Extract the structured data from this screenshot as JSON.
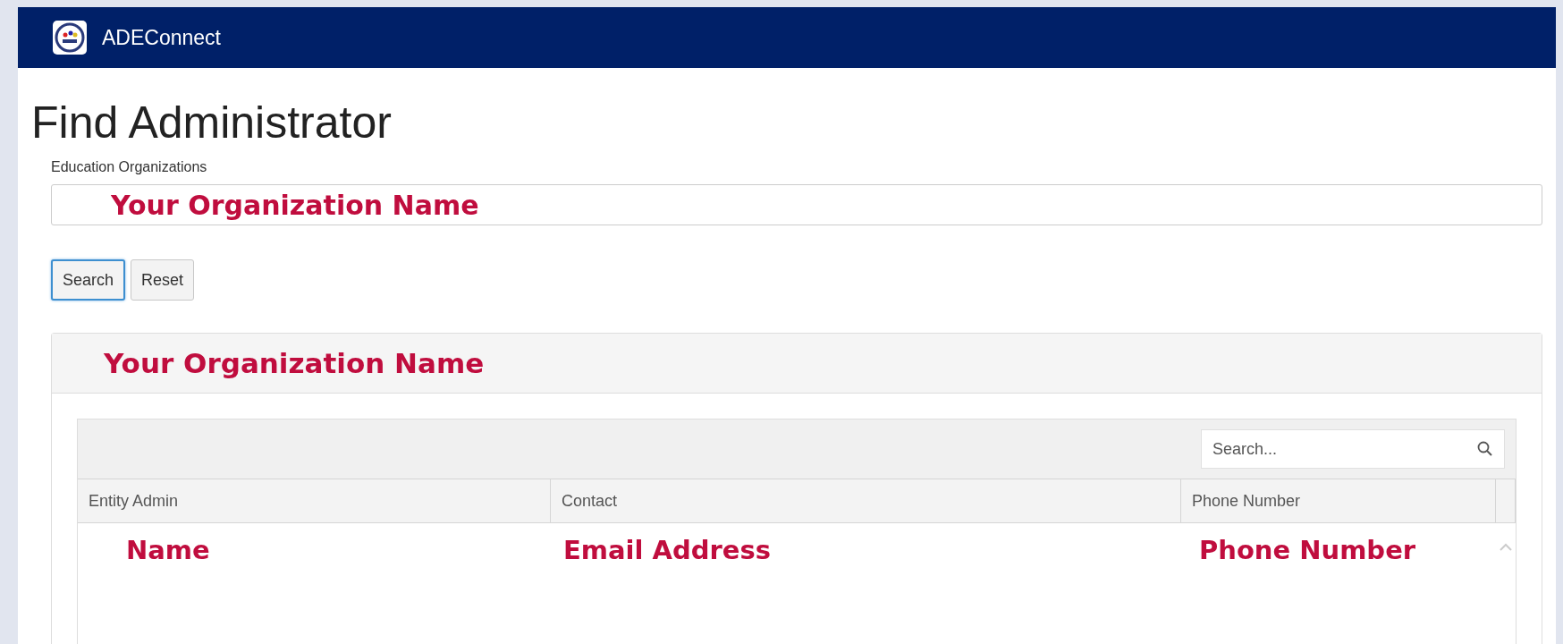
{
  "navbar": {
    "brand": "ADEConnect"
  },
  "page_title": "Find Administrator",
  "org_field": {
    "label": "Education Organizations",
    "value": "Your Organization Name"
  },
  "buttons": [
    {
      "label": "Search",
      "focused": true
    },
    {
      "label": "Reset",
      "focused": false
    }
  ],
  "panel": {
    "title": "Your Organization Name",
    "grid_search": {
      "placeholder": "Search..."
    },
    "columns": [
      "Entity Admin",
      "Contact",
      "Phone Number"
    ],
    "rows": [
      [
        "Name",
        "Email Address",
        "Phone Number"
      ]
    ]
  }
}
